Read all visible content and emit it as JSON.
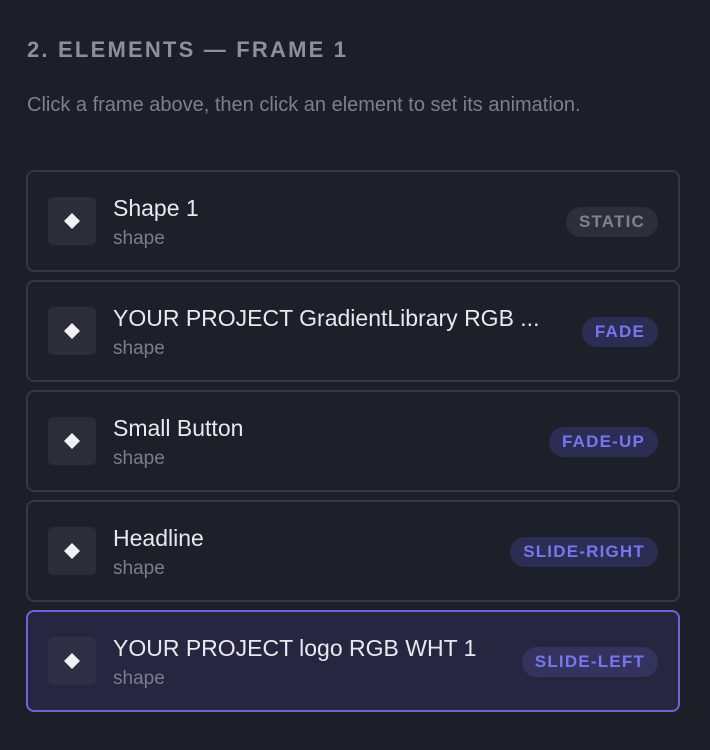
{
  "section": {
    "title": "2. ELEMENTS — FRAME 1",
    "description": "Click a frame above, then click an element to set its animation."
  },
  "colors": {
    "background": "#1c1f27",
    "selected_border": "#6a66d8",
    "badge_accent": "#7776f0"
  },
  "elements": [
    {
      "name": "Shape 1",
      "kind": "shape",
      "animation": "STATIC",
      "selected": false,
      "icon": "diamond-icon"
    },
    {
      "name": "YOUR PROJECT GradientLibrary RGB ...",
      "kind": "shape",
      "animation": "FADE",
      "selected": false,
      "icon": "diamond-icon"
    },
    {
      "name": "Small Button",
      "kind": "shape",
      "animation": "FADE-UP",
      "selected": false,
      "icon": "diamond-icon"
    },
    {
      "name": "Headline",
      "kind": "shape",
      "animation": "SLIDE-RIGHT",
      "selected": false,
      "icon": "diamond-icon"
    },
    {
      "name": "YOUR PROJECT logo RGB WHT 1",
      "kind": "shape",
      "animation": "SLIDE-LEFT",
      "selected": true,
      "icon": "diamond-icon"
    }
  ]
}
